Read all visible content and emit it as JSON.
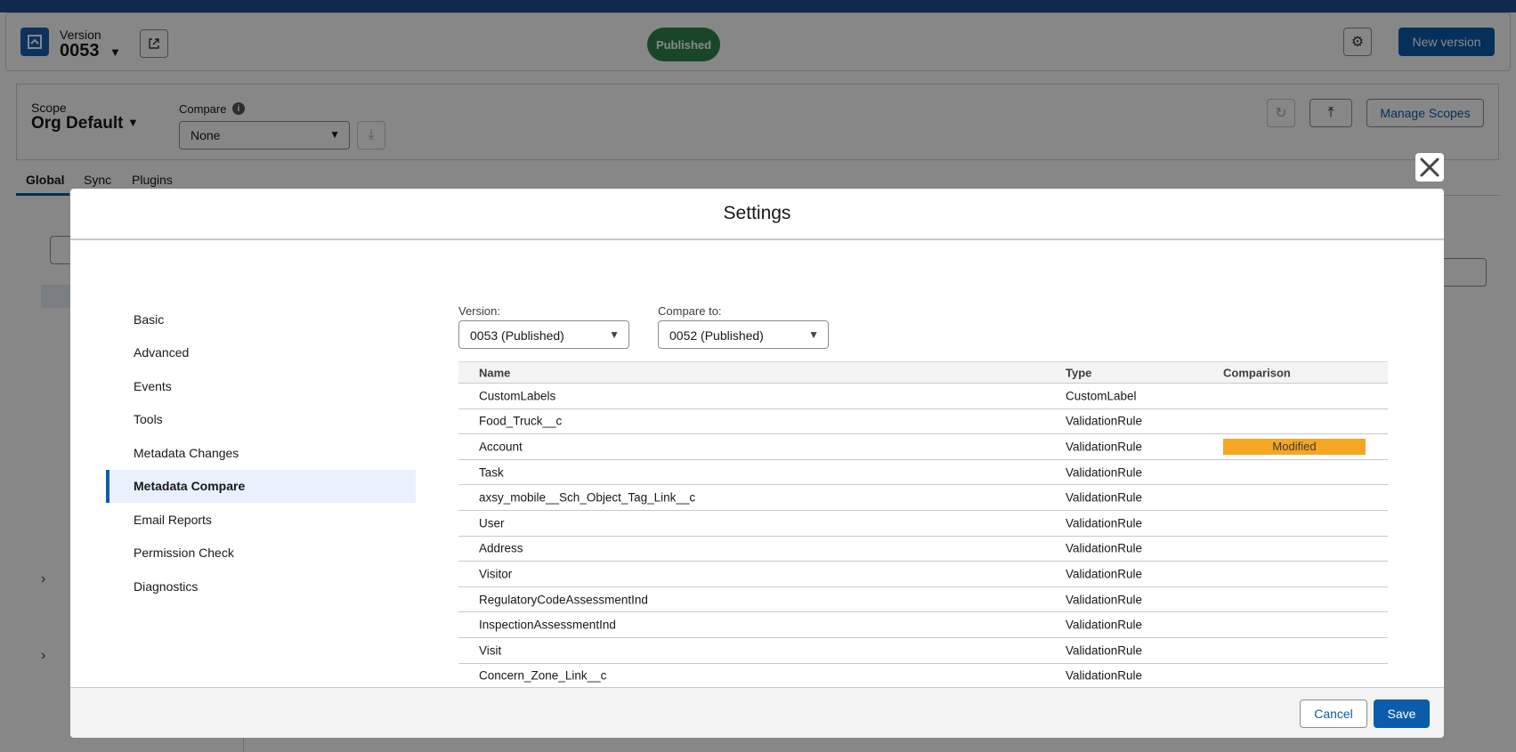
{
  "header": {
    "version_label": "Version",
    "version_number": "0053",
    "status": "Published",
    "new_version_label": "New version"
  },
  "scope": {
    "label": "Scope",
    "value": "Org Default",
    "compare_label": "Compare",
    "compare_value": "None",
    "manage_label": "Manage Scopes"
  },
  "tabs": [
    {
      "label": "Global"
    },
    {
      "label": "Sync"
    },
    {
      "label": "Plugins"
    }
  ],
  "modal": {
    "title": "Settings",
    "nav": [
      {
        "label": "Basic"
      },
      {
        "label": "Advanced"
      },
      {
        "label": "Events"
      },
      {
        "label": "Tools"
      },
      {
        "label": "Metadata Changes"
      },
      {
        "label": "Metadata Compare",
        "active": true
      },
      {
        "label": "Email Reports"
      },
      {
        "label": "Permission Check"
      },
      {
        "label": "Diagnostics"
      }
    ],
    "version_label": "Version:",
    "version_value": "0053 (Published)",
    "compare_to_label": "Compare to:",
    "compare_to_value": "0052 (Published)",
    "table": {
      "columns": [
        "Name",
        "Type",
        "Comparison"
      ],
      "rows": [
        {
          "name": "CustomLabels",
          "type": "CustomLabel",
          "comparison": ""
        },
        {
          "name": "Food_Truck__c",
          "type": "ValidationRule",
          "comparison": ""
        },
        {
          "name": "Account",
          "type": "ValidationRule",
          "comparison": "Modified"
        },
        {
          "name": "Task",
          "type": "ValidationRule",
          "comparison": ""
        },
        {
          "name": "axsy_mobile__Sch_Object_Tag_Link__c",
          "type": "ValidationRule",
          "comparison": ""
        },
        {
          "name": "User",
          "type": "ValidationRule",
          "comparison": ""
        },
        {
          "name": "Address",
          "type": "ValidationRule",
          "comparison": ""
        },
        {
          "name": "Visitor",
          "type": "ValidationRule",
          "comparison": ""
        },
        {
          "name": "RegulatoryCodeAssessmentInd",
          "type": "ValidationRule",
          "comparison": ""
        },
        {
          "name": "InspectionAssessmentInd",
          "type": "ValidationRule",
          "comparison": ""
        },
        {
          "name": "Visit",
          "type": "ValidationRule",
          "comparison": ""
        },
        {
          "name": "Concern_Zone_Link__c",
          "type": "ValidationRule",
          "comparison": ""
        }
      ]
    },
    "cancel_label": "Cancel",
    "save_label": "Save"
  },
  "colors": {
    "brand": "#0b5cab",
    "published": "#2e844a",
    "modified": "#f5a623"
  }
}
